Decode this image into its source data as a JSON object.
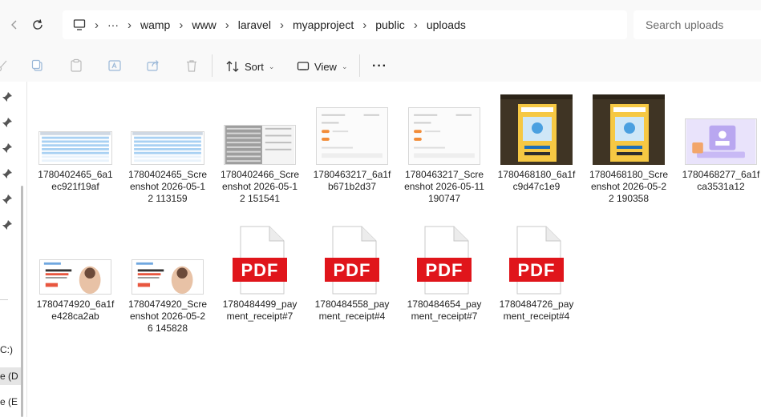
{
  "breadcrumb": {
    "more": "···",
    "items": [
      "wamp",
      "www",
      "laravel",
      "myapproject",
      "public",
      "uploads"
    ]
  },
  "search": {
    "placeholder": "Search uploads"
  },
  "toolbar": {
    "sort_label": "Sort",
    "view_label": "View",
    "more_label": "···"
  },
  "left_nav": {
    "drives": [
      "C:)",
      "e (D",
      "e (E"
    ]
  },
  "files": [
    {
      "name": "1780402465_6a1ec921f19af",
      "kind": "table-blue"
    },
    {
      "name": "1780402465_Screenshot 2026-05-12 113159",
      "kind": "table-blue"
    },
    {
      "name": "1780402466_Screenshot 2026-05-12 151541",
      "kind": "table-gray"
    },
    {
      "name": "1780463217_6a1fb671b2d37",
      "kind": "form"
    },
    {
      "name": "1780463217_Screenshot 2026-05-11 190747",
      "kind": "form"
    },
    {
      "name": "1780468180_6a1fc9d47c1e9",
      "kind": "dark-popup"
    },
    {
      "name": "1780468180_Screenshot 2026-05-22 190358",
      "kind": "dark-popup"
    },
    {
      "name": "1780468277_6a1fca3531a12",
      "kind": "purple"
    },
    {
      "name": "1780474920_6a1fe428ca2ab",
      "kind": "web"
    },
    {
      "name": "1780474920_Screenshot 2026-05-26 145828",
      "kind": "web"
    },
    {
      "name": "1780484499_payment_receipt#7",
      "kind": "pdf"
    },
    {
      "name": "1780484558_payment_receipt#4",
      "kind": "pdf"
    },
    {
      "name": "1780484654_payment_receipt#7",
      "kind": "pdf"
    },
    {
      "name": "1780484726_payment_receipt#4",
      "kind": "pdf"
    }
  ],
  "pdf_badge": "PDF",
  "colors": {
    "pdf_red": "#e0151b",
    "dark_bg": "#3f3424",
    "popup_yellow": "#f6c843",
    "purple": "#b9a7f0"
  }
}
